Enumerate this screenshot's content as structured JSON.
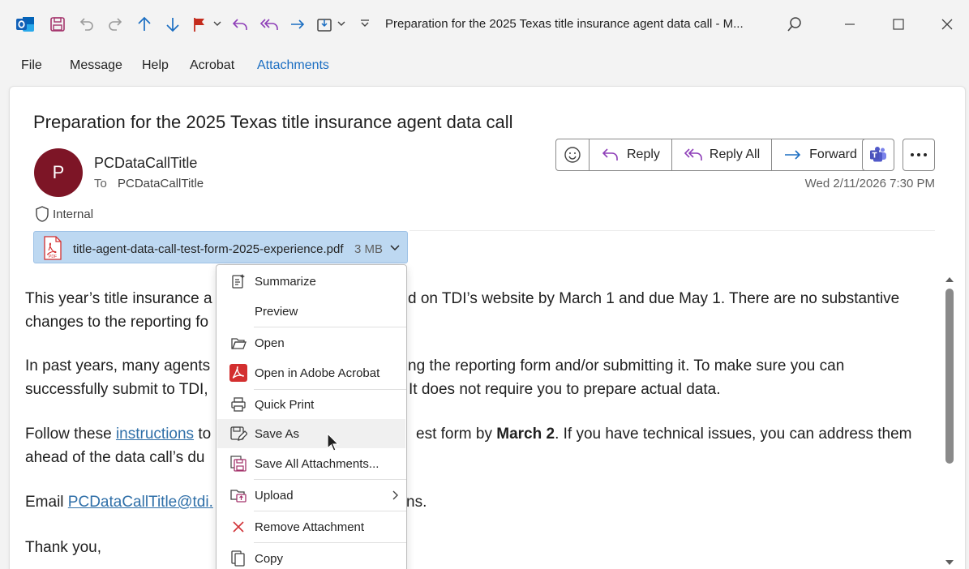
{
  "window": {
    "title": "Preparation for the 2025 Texas title insurance agent data call  -  M..."
  },
  "menu": {
    "items": [
      "File",
      "Message",
      "Help",
      "Acrobat",
      "Attachments"
    ]
  },
  "message": {
    "subject": "Preparation for the 2025 Texas title insurance agent data call",
    "avatar_initial": "P",
    "avatar_color": "#7d1526",
    "sender": "PCDataCallTitle",
    "to_label": "To",
    "to_value": "PCDataCallTitle",
    "sensitivity": "Internal",
    "date": "Wed 2/11/2026 7:30 PM"
  },
  "actions": {
    "reply": "Reply",
    "reply_all": "Reply All",
    "forward": "Forward"
  },
  "attachment": {
    "name": "title-agent-data-call-test-form-2025-experience.pdf",
    "size": "3 MB"
  },
  "body": {
    "p1a": "This year’s title insurance a",
    "p1b": "d on TDI’s website by March 1 and due May 1. There are no substantive",
    "p1c": "changes to the reporting fo",
    "p2a": "In past years, many agents",
    "p2b": "ng the reporting form and/or submitting it. To make sure you can",
    "p2c": "successfully submit to TDI,",
    "p2d": "It does not require you to prepare actual data.",
    "p3a": "Follow these ",
    "p3link": "instructions",
    "p3b": " to",
    "p3c": "est form by ",
    "p3bold": "March 2",
    "p3d": ". If you have technical issues, you can address them",
    "p3e": "ahead of the data call’s du",
    "p4a": "Email ",
    "p4link": "PCDataCallTitle@tdi.",
    "p4b": "ns.",
    "p5": "Thank you,"
  },
  "context_menu": {
    "summarize": "Summarize",
    "preview": "Preview",
    "open": "Open",
    "open_acrobat": "Open in Adobe Acrobat",
    "quick_print": "Quick Print",
    "save_as": "Save As",
    "save_all": "Save All Attachments...",
    "upload": "Upload",
    "remove": "Remove Attachment",
    "copy": "Copy"
  },
  "colors": {
    "accent": "#1b6ec2",
    "attachment_bg": "#bdd8f1",
    "pdf_red": "#d32f2f"
  }
}
